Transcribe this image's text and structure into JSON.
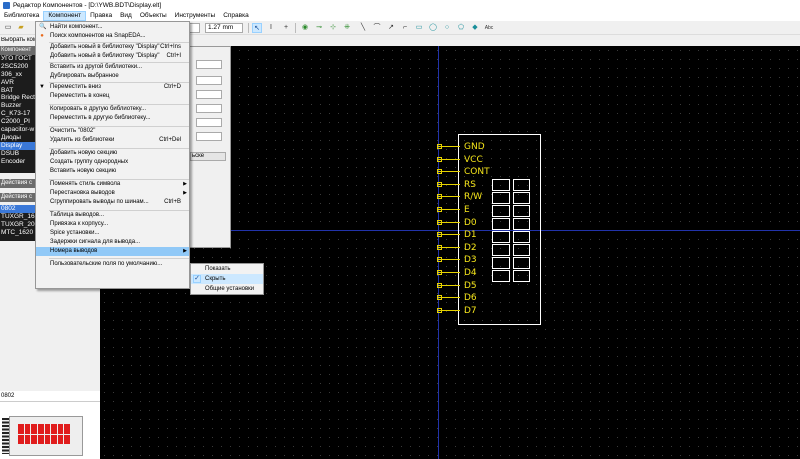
{
  "window": {
    "title": "Редактор Компонентов - [D:\\YWB.BDT\\Display.elt]"
  },
  "menubar": [
    "Библиотека",
    "Компонент",
    "Правка",
    "Вид",
    "Объекты",
    "Инструменты",
    "Справка"
  ],
  "toolbar": {
    "zoom_value": "",
    "grid_value": "1.27 mm"
  },
  "left_panel": {
    "select_label": "Выбрать компо",
    "components_header": "Компонент",
    "components": [
      "УГО ГОСТ",
      "2SC5200",
      "306_xx",
      "AVR",
      "BAT",
      "Bridge Rect",
      "Buzzer",
      "C_K73-17",
      "C2000_PI",
      "capacitor-w",
      "Диоды",
      "Display",
      "DSUB",
      "Encoder"
    ],
    "selected_component": "Display",
    "actions_header_1": "Действия с",
    "actions_header_2": "Действия с",
    "variants": [
      "0802",
      "TUXGR_162",
      "TUXGR_202",
      "MTC_1620"
    ],
    "selected_variant": "0802",
    "bottom_label": "0802"
  },
  "dialog": {
    "button_label": "ьскe"
  },
  "menu": {
    "items": [
      {
        "icon": "search-icon",
        "glyph": "🔍",
        "label": "Найти компонент...",
        "shortcut": ""
      },
      {
        "icon": "snapeda-icon",
        "glyph": "●",
        "label": "Поиск компонентов на SnapEDA...",
        "shortcut": ""
      },
      {
        "label": "Добавить новый в библиотеку \"Display\"",
        "shortcut": "Ctrl+Ins"
      },
      {
        "label": "Добавить новый в библиотеку \"Display\"",
        "shortcut": "Ctrl+I"
      },
      {
        "label": "Вставить из другой библиотеки...",
        "shortcut": ""
      },
      {
        "label": "Дублировать выбранное",
        "shortcut": ""
      },
      {
        "icon": "down-arrow-icon",
        "glyph": "▼",
        "label": "Переместить вниз",
        "shortcut": "Ctrl+D"
      },
      {
        "label": "Переместить в конец",
        "shortcut": ""
      },
      {
        "label": "Копировать в другую библиотеку...",
        "shortcut": ""
      },
      {
        "label": "Переместить в другую библиотеку...",
        "shortcut": ""
      },
      {
        "label": "Очистить \"0802\"",
        "shortcut": ""
      },
      {
        "label": "Удалить из библиотеки",
        "shortcut": "Ctrl+Del"
      },
      {
        "label": "Добавить новую секцию",
        "shortcut": ""
      },
      {
        "label": "Создать группу однородных",
        "shortcut": ""
      },
      {
        "label": "Вставить новую секцию",
        "shortcut": ""
      },
      {
        "label": "Поменять стиль символа",
        "shortcut": "",
        "submenu": true
      },
      {
        "label": "Перестановка выводов",
        "shortcut": "",
        "submenu": true
      },
      {
        "label": "Сгруппировать выводы по шинам...",
        "shortcut": "Ctrl+B"
      },
      {
        "label": "Таблица выводов...",
        "shortcut": ""
      },
      {
        "label": "Привязка к корпусу...",
        "shortcut": ""
      },
      {
        "label": "Spice установки...",
        "shortcut": ""
      },
      {
        "label": "Задержки сигнала для вывода...",
        "shortcut": ""
      },
      {
        "label": "Номера выводов",
        "shortcut": "",
        "submenu": true,
        "highlighted": true
      },
      {
        "label": "Пользовательские поля по умолчанию...",
        "shortcut": ""
      }
    ]
  },
  "submenu": {
    "items": [
      "Показать",
      "Скрыть",
      "Общие установки"
    ],
    "checked_index": 1
  },
  "schematic": {
    "pins": [
      "GND",
      "VCC",
      "CONT",
      "RS",
      "R/W",
      "E",
      "D0",
      "D1",
      "D2",
      "D3",
      "D4",
      "D5",
      "D6",
      "D7"
    ],
    "pin_color": "#f5e51a",
    "outline_color": "#ffffff"
  }
}
